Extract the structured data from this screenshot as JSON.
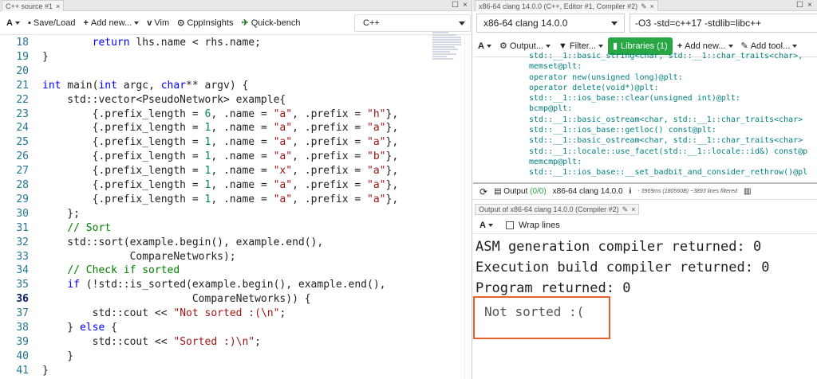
{
  "left": {
    "tab_title": "C++ source #1",
    "toolbar": {
      "font_button": "A",
      "save_load": "Save/Load",
      "add_new": "Add new...",
      "vim": "Vim",
      "cppinsights": "CppInsights",
      "quickbench": "Quick-bench",
      "language": "C++"
    },
    "code": [
      {
        "n": "18",
        "t": "        return lhs.name < rhs.name;"
      },
      {
        "n": "19",
        "t": "}"
      },
      {
        "n": "20",
        "t": ""
      },
      {
        "n": "21",
        "t": "int main(int argc, char** argv) {"
      },
      {
        "n": "22",
        "t": "    std::vector<PseudoNetwork> example{"
      },
      {
        "n": "23",
        "t": "        {.prefix_length = 6, .name = \"a\", .prefix = \"h\"},"
      },
      {
        "n": "24",
        "t": "        {.prefix_length = 1, .name = \"a\", .prefix = \"a\"},"
      },
      {
        "n": "25",
        "t": "        {.prefix_length = 1, .name = \"a\", .prefix = \"a\"},"
      },
      {
        "n": "26",
        "t": "        {.prefix_length = 1, .name = \"a\", .prefix = \"b\"},"
      },
      {
        "n": "27",
        "t": "        {.prefix_length = 1, .name = \"x\", .prefix = \"a\"},"
      },
      {
        "n": "28",
        "t": "        {.prefix_length = 1, .name = \"a\", .prefix = \"a\"},"
      },
      {
        "n": "29",
        "t": "        {.prefix_length = 1, .name = \"a\", .prefix = \"a\"},"
      },
      {
        "n": "30",
        "t": "    };"
      },
      {
        "n": "31",
        "t": "    // Sort"
      },
      {
        "n": "32",
        "t": "    std::sort(example.begin(), example.end(),"
      },
      {
        "n": "33",
        "t": "              CompareNetworks);"
      },
      {
        "n": "34",
        "t": "    // Check if sorted"
      },
      {
        "n": "35",
        "t": "    if (!std::is_sorted(example.begin(), example.end(),"
      },
      {
        "n": "36",
        "t": "                        CompareNetworks)) {"
      },
      {
        "n": "37",
        "t": "        std::cout << \"Not sorted :(\\n\";"
      },
      {
        "n": "38",
        "t": "    } else {"
      },
      {
        "n": "39",
        "t": "        std::cout << \"Sorted :)\\n\";"
      },
      {
        "n": "40",
        "t": "    }"
      },
      {
        "n": "41",
        "t": "}"
      }
    ]
  },
  "right": {
    "tab_title": "x86-64 clang 14.0.0 (C++, Editor #1, Compiler #2)",
    "compiler": "x86-64 clang 14.0.0",
    "options": "-O3 -std=c++17 -stdlib=libc++",
    "toolbar": {
      "font_button": "A",
      "output": "Output...",
      "filter": "Filter...",
      "libraries": "Libraries (1)",
      "add_new": "Add new...",
      "add_tool": "Add tool..."
    },
    "asm": [
      "std::__1::basic_string<char, std::__1::char_traits<char>,",
      "memset@plt:",
      "operator new(unsigned long)@plt:",
      "operator delete(void*)@plt:",
      "std::__1::ios_base::clear(unsigned int)@plt:",
      "bcmp@plt:",
      "std::__1::basic_ostream<char, std::__1::char_traits<char>",
      "std::__1::ios_base::getloc() const@plt:",
      "std::__1::basic_ostream<char, std::__1::char_traits<char>",
      "std::__1::locale::use_facet(std::__1::locale::id&) const@p",
      "memcmp@plt:",
      "std::__1::ios_base::__set_badbit_and_consider_rethrow()@pl"
    ],
    "status": {
      "output_label": "Output",
      "output_count": "(0/0)",
      "compiler": "x86-64 clang 14.0.0",
      "info": "i",
      "stats": "- 3969ms (180560B) ~3893 lines filtered"
    },
    "output_pane": {
      "tab_title": "Output of x86-64 clang 14.0.0 (Compiler #2)",
      "font_button": "A",
      "wrap_lines": "Wrap lines",
      "lines": [
        "ASM generation compiler returned: 0",
        "Execution build compiler returned: 0",
        "Program returned: 0"
      ],
      "stdout": "Not sorted :("
    }
  }
}
